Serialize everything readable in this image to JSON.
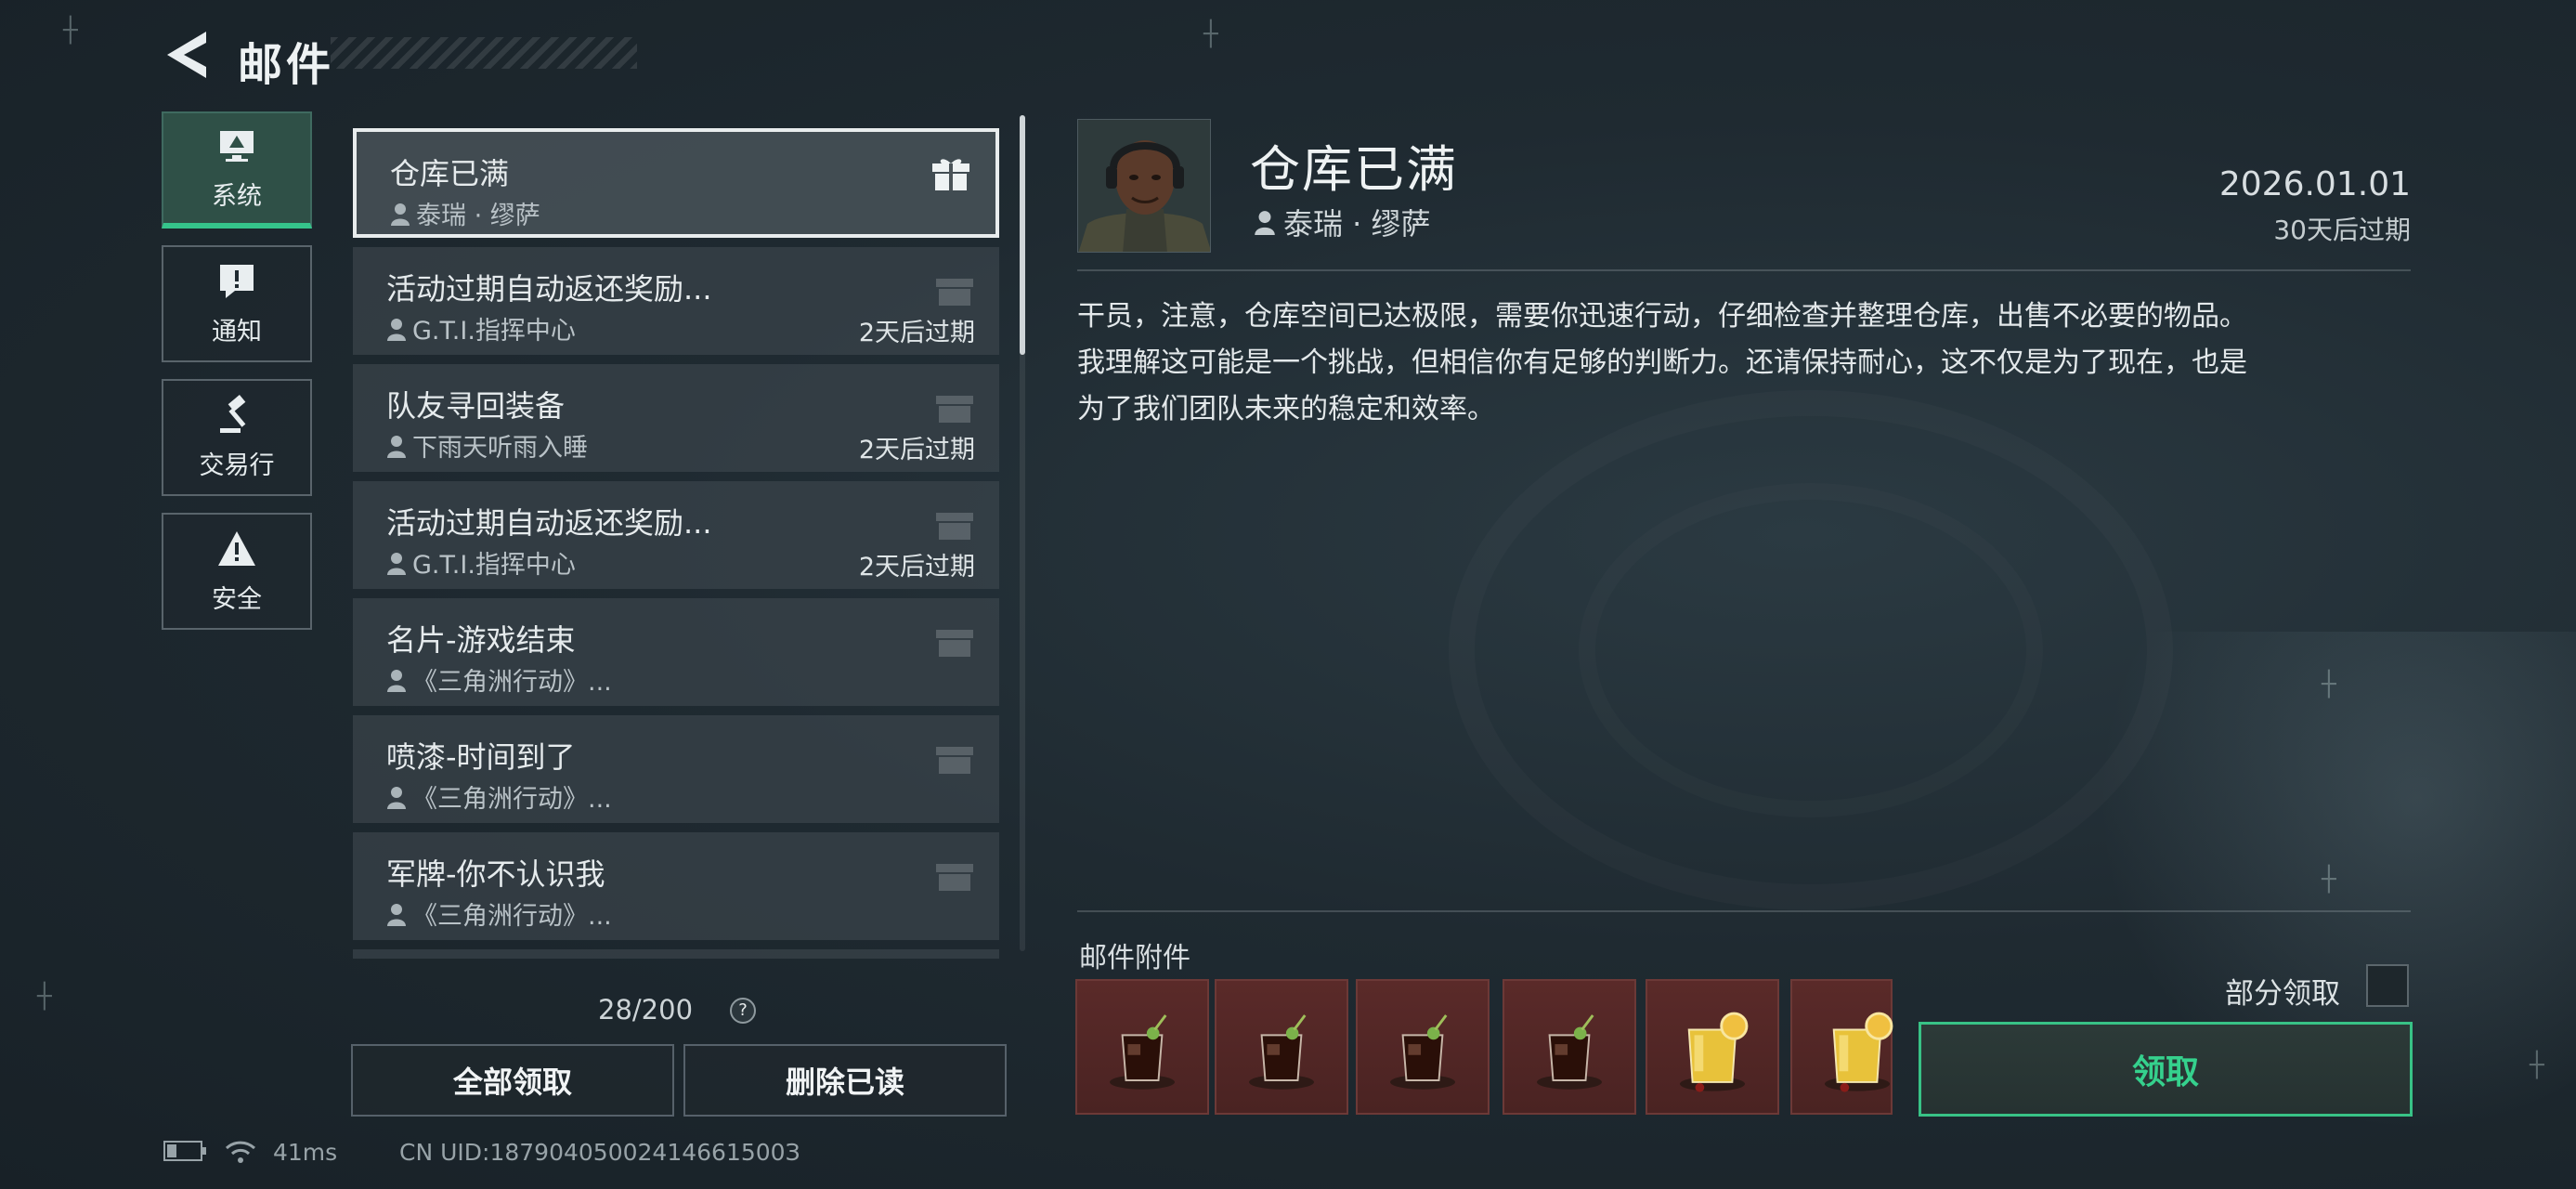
{
  "header": {
    "title": "邮件",
    "back_icon": "back-arrow-icon"
  },
  "categories": [
    {
      "label": "系统",
      "icon": "monitor-icon",
      "active": true
    },
    {
      "label": "通知",
      "icon": "alert-message-icon",
      "active": false
    },
    {
      "label": "交易行",
      "icon": "gavel-icon",
      "active": false
    },
    {
      "label": "安全",
      "icon": "warning-icon",
      "active": false
    }
  ],
  "mails": [
    {
      "subject": "仓库已满",
      "sender": "泰瑞 · 缪萨",
      "expire": ""
    },
    {
      "subject": "活动过期自动返还奖励...",
      "sender": "G.T.I.指挥中心",
      "expire": "2天后过期"
    },
    {
      "subject": "队友寻回装备",
      "sender": "下雨天听雨入睡",
      "expire": "2天后过期"
    },
    {
      "subject": "活动过期自动返还奖励...",
      "sender": "G.T.I.指挥中心",
      "expire": "2天后过期"
    },
    {
      "subject": "名片-游戏结束",
      "sender": "《三角洲行动》...",
      "expire": ""
    },
    {
      "subject": "喷漆-时间到了",
      "sender": "《三角洲行动》...",
      "expire": ""
    },
    {
      "subject": "军牌-你不认识我",
      "sender": "《三角洲行动》...",
      "expire": ""
    }
  ],
  "list_footer": {
    "count": "28/200",
    "help": "?"
  },
  "actions": {
    "claim_all": "全部领取",
    "delete_read": "删除已读"
  },
  "status_bar": {
    "latency": "41ms",
    "uid": "CN UID:18790405002414661500З"
  },
  "detail": {
    "title": "仓库已满",
    "sender": "泰瑞 · 缪萨",
    "date": "2026.01.01",
    "expire": "30天后过期",
    "body": [
      "干员，注意，仓库空间已达极限，需要你迅速行动，仔细检查并整理仓库，出售不必要的物品。",
      "我理解这可能是一个挑战，但相信你有足够的判断力。还请保持耐心，这不仅是为了现在，也是",
      "为了我们团队未来的稳定和效率。"
    ],
    "attachments_label": "邮件附件",
    "attachments": [
      "cola-drink-icon",
      "cola-drink-icon",
      "cola-drink-icon",
      "cola-drink-icon",
      "lemon-drink-icon",
      "lemon-drink-icon"
    ],
    "partial_claim_label": "部分领取",
    "claim_button": "领取"
  },
  "colors": {
    "accent": "#35c48b",
    "attachment_bg": "#552827"
  }
}
